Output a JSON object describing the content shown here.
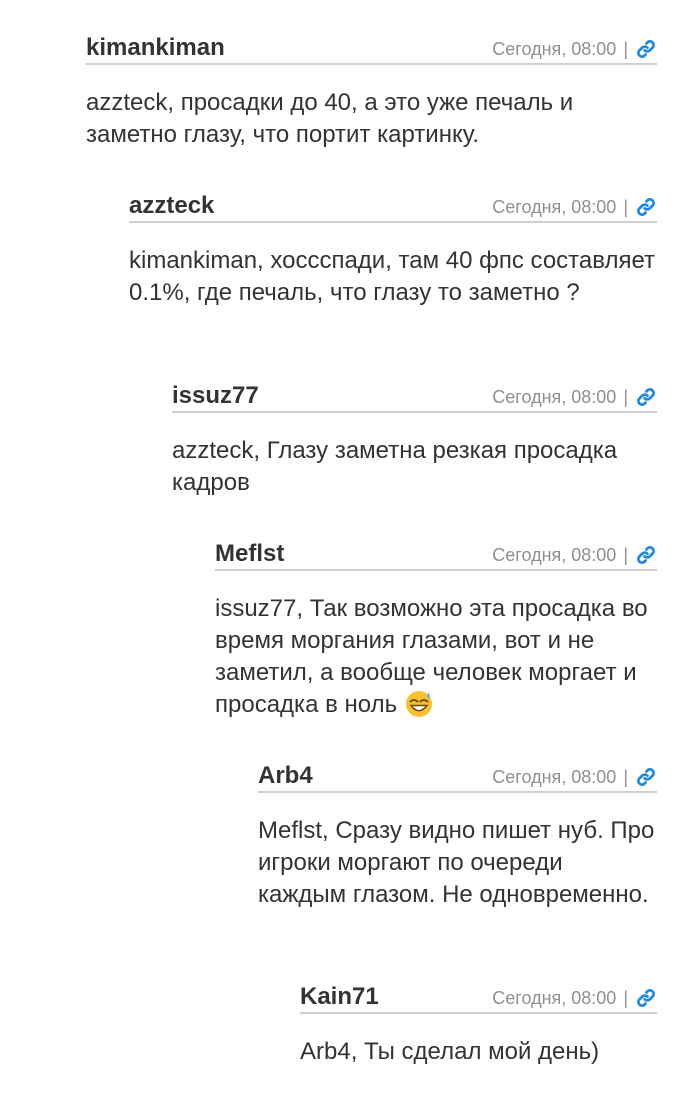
{
  "comments": [
    {
      "author": "kimankiman",
      "time": "Сегодня, 08:00",
      "separator": "|",
      "text": "azzteck, просадки до 40, а это уже печаль и заметно глазу, что портит картинку."
    },
    {
      "author": "azzteck",
      "time": "Сегодня, 08:00",
      "separator": "|",
      "text": "kimankiman, хоссспади, там 40 фпс составляет 0.1%, где печаль, что глазу то заметно ?"
    },
    {
      "author": "issuz77",
      "time": "Сегодня, 08:00",
      "separator": "|",
      "text": "azzteck, Глазу заметна резкая просадка кадров"
    },
    {
      "author": "Meflst",
      "time": "Сегодня, 08:00",
      "separator": "|",
      "text": "issuz77, Так возможно эта просадка во время моргания глазами, вот и не заметил, а вообще человек моргает и просадка в ноль",
      "emoji": "grinning-sweat-emoji"
    },
    {
      "author": "Arb4",
      "time": "Сегодня, 08:00",
      "separator": "|",
      "text": "Meflst, Сразу видно пишет нуб. Про игроки моргают по очереди каждым глазом. Не одновременно."
    },
    {
      "author": "Kain71",
      "time": "Сегодня, 08:00",
      "separator": "|",
      "text": "Arb4, Ты сделал мой день)"
    }
  ],
  "link_icon": "link-chain-icon",
  "colors": {
    "text": "#333333",
    "meta": "#8f8f8f",
    "divider": "#cfcfcf",
    "link": "#1e88e5"
  }
}
